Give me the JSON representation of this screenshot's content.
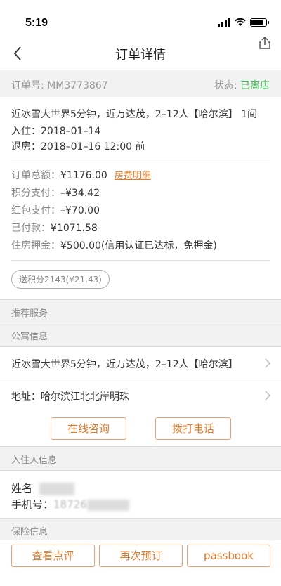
{
  "status_bar": {
    "time": "5:19"
  },
  "nav": {
    "title": "订单详情"
  },
  "order": {
    "number_label": "订单号:",
    "number": "MM3773867",
    "status_label": "状态:",
    "status_value": "已离店",
    "status_color": "#35b84c"
  },
  "booking": {
    "hotel": "近冰雪大世界5分钟，近万达茂，2–12人【哈尔滨】 1间",
    "checkin": "入住：2018–01–14",
    "checkout": "退房：2018–01–16 12:00 前"
  },
  "payment": {
    "total_label": "订单总额：",
    "total": "¥1176.00",
    "detail_link": "房费明细",
    "points_label": "积分支付：",
    "points": "–¥34.42",
    "redpacket_label": "红包支付：",
    "redpacket": "–¥70.00",
    "paid_label": "已付款：",
    "paid": "¥1071.58",
    "deposit_label": "住房押金：",
    "deposit": "¥500.00(信用认证已达标，免押金)"
  },
  "points_badge": "送积分2143(¥21.43)",
  "sections": {
    "recommend": "推荐服务",
    "apartment": "公寓信息",
    "guest": "入住人信息",
    "insurance": "保险信息"
  },
  "apartment": {
    "name": "近冰雪大世界5分钟，近万达茂，2–12人【哈尔滨】",
    "address": "地址：哈尔滨江北北岸明珠"
  },
  "actions": {
    "consult": "在线咨询",
    "call": "拨打电话"
  },
  "guest": {
    "name_label": "姓名",
    "phone_label": "手机号：",
    "phone_partial": "18726"
  },
  "bottom": {
    "review": "查看点评",
    "rebook": "再次预订",
    "passbook": "passbook"
  },
  "colors": {
    "accent": "#e07a2c",
    "success": "#35b84c"
  }
}
